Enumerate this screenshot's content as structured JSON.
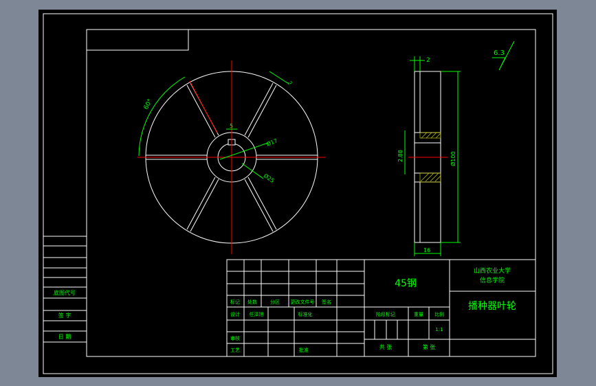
{
  "colors": {
    "background": "#7d8796",
    "sheet": "#000000",
    "frame": "#ffffff",
    "text_green": "#00ff00",
    "text_yellow": "#ffff00",
    "centerline_red": "#ff0000",
    "hatch_yellow": "#c8c800"
  },
  "drawing": {
    "surface_finish": "6.3",
    "front_view": {
      "angle_label": "60°",
      "rib_width_label": "2",
      "bore_label": "Ø17",
      "hub_label": "Ø25",
      "key_label": "5"
    },
    "side_view": {
      "width_top_label": "2",
      "bore_offset_label": "2.88",
      "diameter_label": "Ø100",
      "thickness_label": "16"
    }
  },
  "title_block": {
    "material": "45钢",
    "school_line1": "山西农业大学",
    "school_line2": "信息学院",
    "part_name": "播种器叶轮",
    "rev_headers": [
      "标记",
      "处数",
      "分区",
      "更改文件号",
      "签名"
    ],
    "row_design": "设计",
    "row_designer": "任泽旭",
    "row_standard": "标准化",
    "row_review": "审核",
    "row_process": "工艺",
    "row_approve": "批准",
    "stage_mark": "阶段标记",
    "weight": "重量",
    "scale": "比例",
    "scale_value": "1:1",
    "total_sheets": "共 张",
    "sheet_no": "第 张"
  },
  "left_strip": {
    "old_drawing_no": "底图代号",
    "signature": "签 字",
    "date": "日 期"
  }
}
